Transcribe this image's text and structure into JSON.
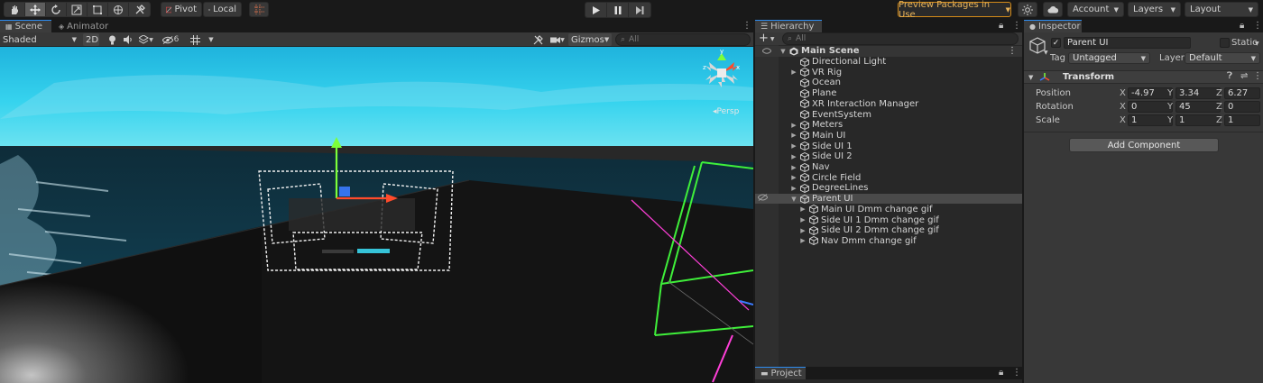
{
  "toolbar": {
    "tools": [
      "hand-tool-icon",
      "move-tool-icon",
      "rotate-tool-icon",
      "scale-tool-icon",
      "rect-tool-icon",
      "transform-tool-icon",
      "custom-tool-icon"
    ],
    "pivot_label": "Pivot",
    "local_label": "Local",
    "preview_packages_label": "Preview Packages in Use",
    "account_label": "Account",
    "layers_label": "Layers",
    "layout_label": "Layout"
  },
  "scene": {
    "tab_scene": "Scene",
    "tab_animator": "Animator",
    "shading_mode": "Shaded",
    "mode_2d": "2D",
    "hidden_count": "6",
    "gizmos_label": "Gizmos",
    "search_placeholder": "All",
    "persp_label": "Persp",
    "gizmo_axes": [
      "y",
      "z",
      "x"
    ]
  },
  "hierarchy": {
    "tab_label": "Hierarchy",
    "search_placeholder": "All",
    "root_label": "Main Scene",
    "items": [
      {
        "label": "Directional Light",
        "depth": 1,
        "expandable": false
      },
      {
        "label": "VR Rig",
        "depth": 1,
        "expandable": true
      },
      {
        "label": "Ocean",
        "depth": 1,
        "expandable": false
      },
      {
        "label": "Plane",
        "depth": 1,
        "expandable": false
      },
      {
        "label": "XR Interaction Manager",
        "depth": 1,
        "expandable": false
      },
      {
        "label": "EventSystem",
        "depth": 1,
        "expandable": false
      },
      {
        "label": "Meters",
        "depth": 1,
        "expandable": true
      },
      {
        "label": "Main UI",
        "depth": 1,
        "expandable": true
      },
      {
        "label": "Side UI 1",
        "depth": 1,
        "expandable": true
      },
      {
        "label": "Side UI 2",
        "depth": 1,
        "expandable": true
      },
      {
        "label": "Nav",
        "depth": 1,
        "expandable": true
      },
      {
        "label": "Circle Field",
        "depth": 1,
        "expandable": true
      },
      {
        "label": "DegreeLines",
        "depth": 1,
        "expandable": true
      },
      {
        "label": "Parent UI",
        "depth": 1,
        "expandable": true,
        "expanded": true,
        "selected": true
      },
      {
        "label": "Main UI Dmm change gif",
        "depth": 2,
        "expandable": true
      },
      {
        "label": "Side UI 1 Dmm change gif",
        "depth": 2,
        "expandable": true
      },
      {
        "label": "Side UI 2 Dmm change gif",
        "depth": 2,
        "expandable": true
      },
      {
        "label": "Nav Dmm change gif",
        "depth": 2,
        "expandable": true
      }
    ]
  },
  "project": {
    "tab_label": "Project"
  },
  "inspector": {
    "tab_label": "Inspector",
    "object_name": "Parent UI",
    "active": true,
    "static_label": "Static",
    "tag_label": "Tag",
    "tag_value": "Untagged",
    "layer_label": "Layer",
    "layer_value": "Default",
    "transform": {
      "title": "Transform",
      "position_label": "Position",
      "rotation_label": "Rotation",
      "scale_label": "Scale",
      "position": {
        "x": "-4.97",
        "y": "3.34",
        "z": "6.27"
      },
      "rotation": {
        "x": "0",
        "y": "45",
        "z": "0"
      },
      "scale": {
        "x": "1",
        "y": "1",
        "z": "1"
      }
    },
    "add_component_label": "Add Component"
  },
  "colors": {
    "accent": "#2d8cf0",
    "preview_border": "#d48b19",
    "sky": "#27c6ea",
    "gizmo_green": "#7cff3a",
    "gizmo_red": "#ff4b2b",
    "gizmo_blue": "#3b7bff",
    "wire_magenta": "#ff3fd8"
  }
}
